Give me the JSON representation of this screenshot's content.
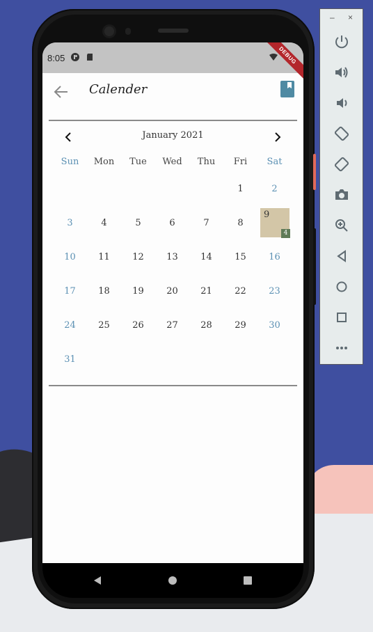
{
  "status_bar": {
    "time": "8:05",
    "debug_label": "DEBUG"
  },
  "app_bar": {
    "title": "Calender"
  },
  "calendar": {
    "month_label": "January 2021",
    "weekdays": [
      "Sun",
      "Mon",
      "Tue",
      "Wed",
      "Thu",
      "Fri",
      "Sat"
    ],
    "rows": [
      [
        "",
        "",
        "",
        "",
        "",
        "1",
        "2"
      ],
      [
        "3",
        "4",
        "5",
        "6",
        "7",
        "8",
        "9"
      ],
      [
        "10",
        "11",
        "12",
        "13",
        "14",
        "15",
        "16"
      ],
      [
        "17",
        "18",
        "19",
        "20",
        "21",
        "22",
        "23"
      ],
      [
        "24",
        "25",
        "26",
        "27",
        "28",
        "29",
        "30"
      ],
      [
        "31",
        "",
        "",
        "",
        "",
        "",
        ""
      ]
    ],
    "selected_day": "9",
    "selected_badge": "4"
  },
  "colors": {
    "weekend": "#5b90b3",
    "selected_bg": "#d3c6a7",
    "badge_bg": "#5f7a57",
    "book_icon": "#4f8aa3"
  },
  "emulator": {
    "window_controls": [
      "minimize-icon",
      "close-icon"
    ],
    "buttons": [
      "power-icon",
      "volume-up-icon",
      "volume-down-icon",
      "rotate-left-icon",
      "rotate-right-icon",
      "camera-icon",
      "zoom-icon",
      "back-icon",
      "home-icon",
      "overview-icon",
      "more-icon"
    ],
    "minimize_glyph": "–",
    "close_glyph": "×"
  }
}
